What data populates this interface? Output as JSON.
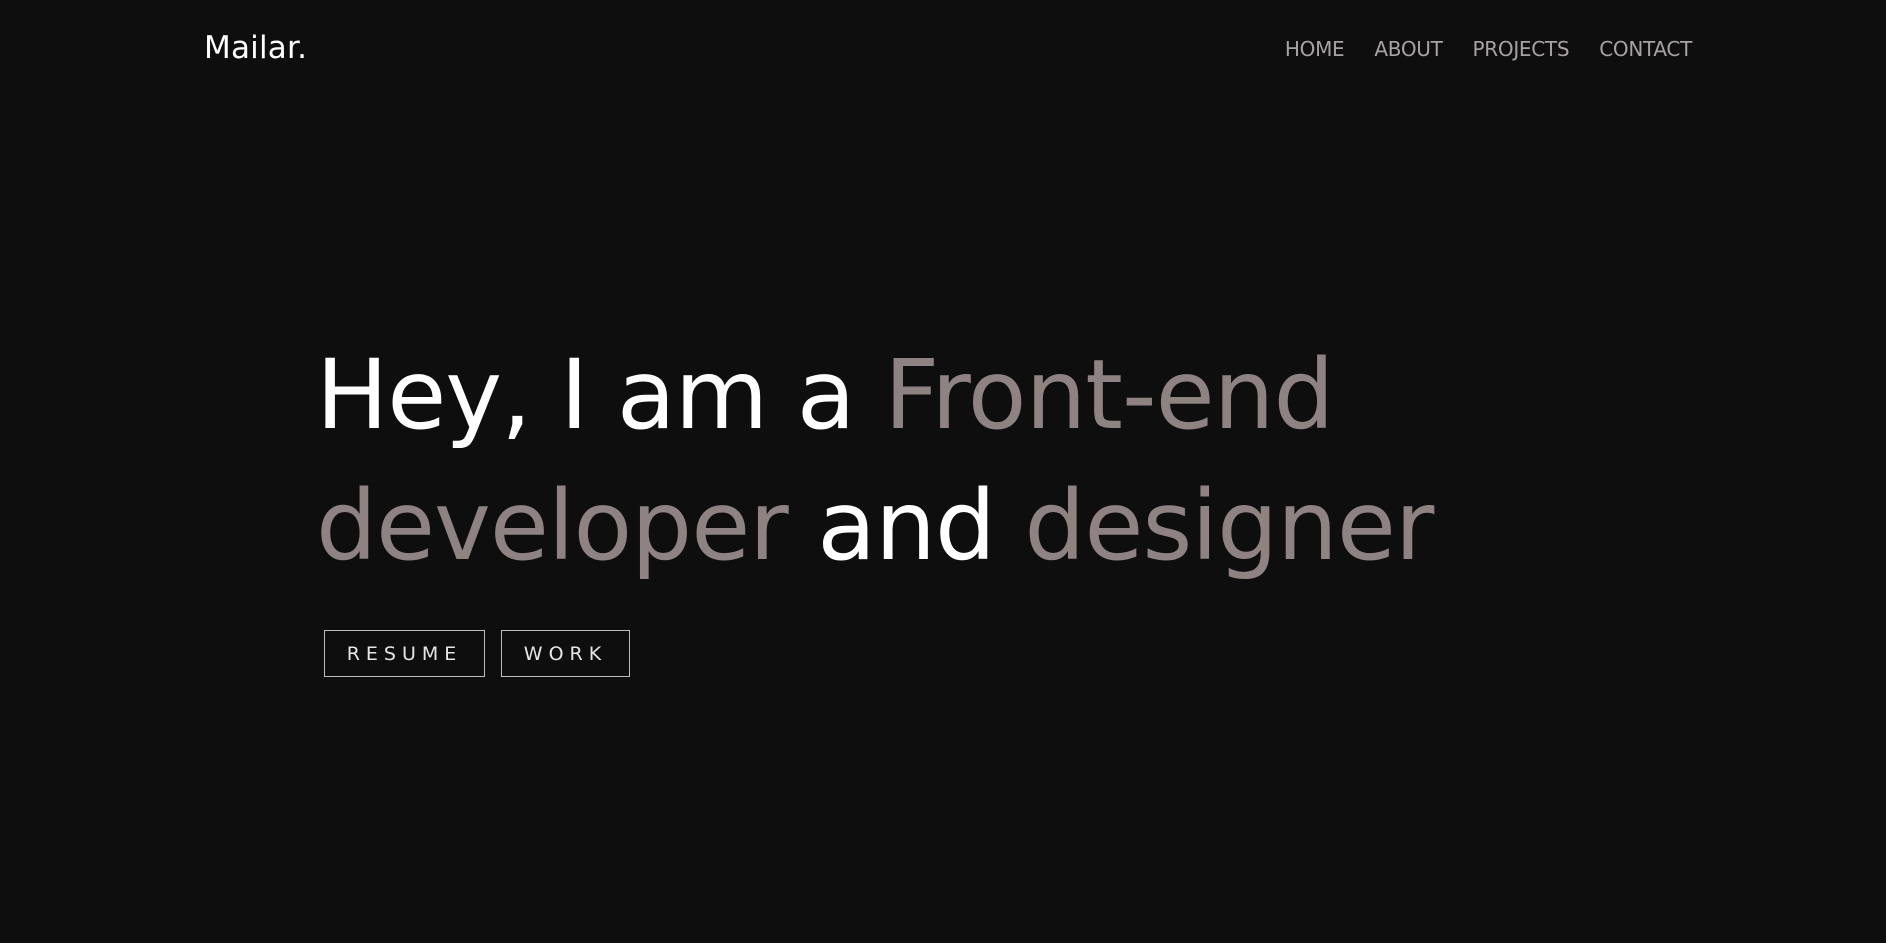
{
  "header": {
    "logo": "Mailar.",
    "nav": [
      {
        "label": "HOME"
      },
      {
        "label": "ABOUT"
      },
      {
        "label": "PROJECTS"
      },
      {
        "label": "CONTACT"
      }
    ]
  },
  "hero": {
    "part1": "Hey, I am a ",
    "part2": "Front-end",
    "part3": "developer",
    "part4": " and ",
    "part5": "designer",
    "buttons": {
      "resume": "RESUME",
      "work": "WORK"
    }
  },
  "colors": {
    "background": "#0e0e0e",
    "text": "#ffffff",
    "accent": "#8e8282",
    "nav": "#a8a2a2"
  }
}
